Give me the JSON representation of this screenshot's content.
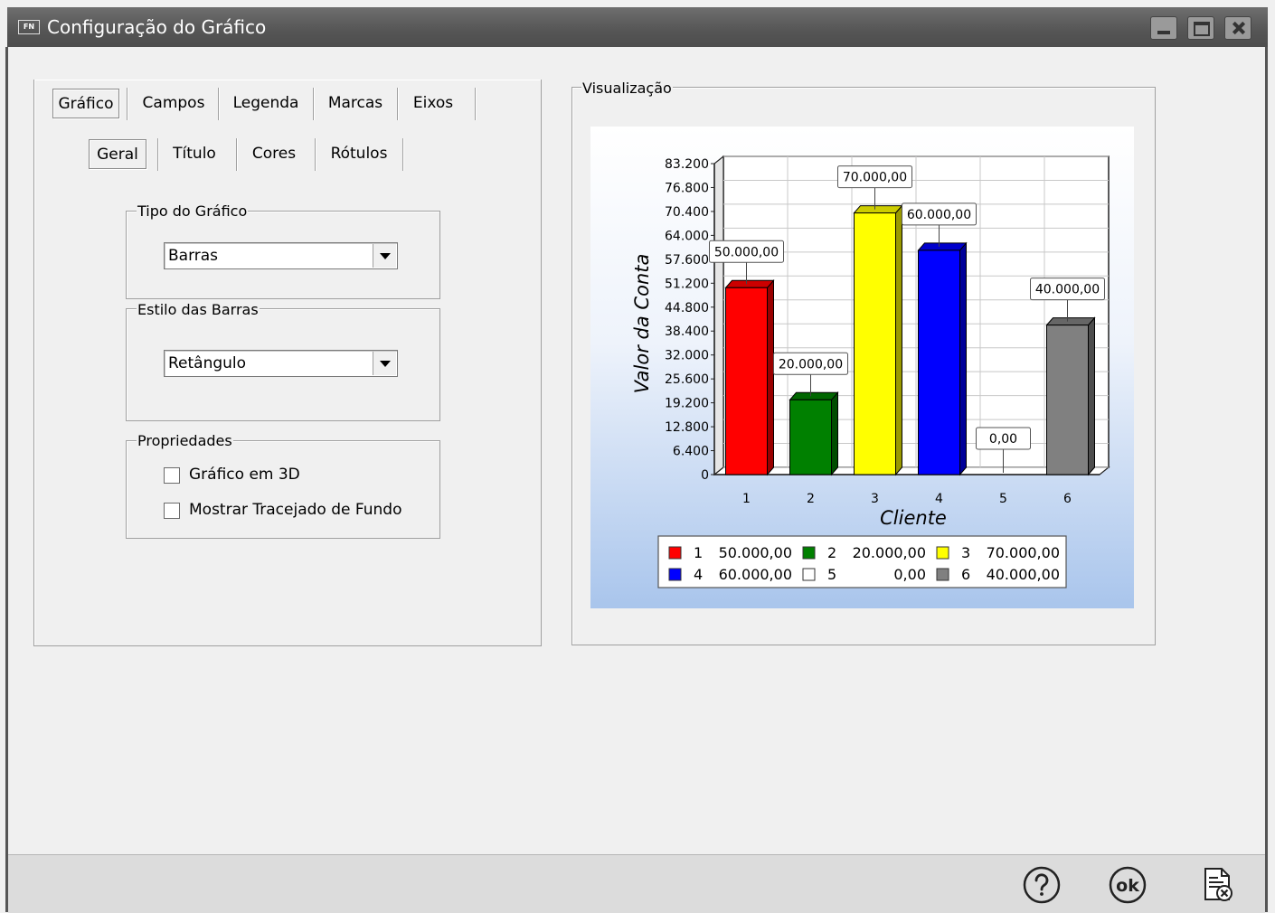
{
  "window": {
    "title": "Configuração do Gráfico",
    "app_icon": "FN"
  },
  "tabs_main": [
    {
      "label": "Gráfico",
      "active": true
    },
    {
      "label": "Campos",
      "active": false
    },
    {
      "label": "Legenda",
      "active": false
    },
    {
      "label": "Marcas",
      "active": false
    },
    {
      "label": "Eixos",
      "active": false
    }
  ],
  "tabs_sub": [
    {
      "label": "Geral",
      "active": true
    },
    {
      "label": "Título",
      "active": false
    },
    {
      "label": "Cores",
      "active": false
    },
    {
      "label": "Rótulos",
      "active": false
    }
  ],
  "tipo_grafico": {
    "legend": "Tipo do Gráfico",
    "value": "Barras"
  },
  "estilo_barras": {
    "legend": "Estilo das Barras",
    "value": "Retângulo"
  },
  "propriedades": {
    "legend": "Propriedades",
    "checkboxes": [
      {
        "label": "Gráfico em 3D",
        "checked": false
      },
      {
        "label": "Mostrar Tracejado de Fundo",
        "checked": false
      }
    ]
  },
  "preview": {
    "legend": "Visualização"
  },
  "chart_data": {
    "type": "bar",
    "categories": [
      "1",
      "2",
      "3",
      "4",
      "5",
      "6"
    ],
    "values": [
      50000,
      20000,
      70000,
      60000,
      0,
      40000
    ],
    "data_labels": [
      "50.000,00",
      "20.000,00",
      "70.000,00",
      "60.000,00",
      "0,00",
      "40.000,00"
    ],
    "colors": [
      "#ff0000",
      "#008000",
      "#ffff00",
      "#0000ff",
      "#ffffff",
      "#808080"
    ],
    "ylabel": "Valor da Conta",
    "xlabel": "Cliente",
    "ylim": [
      0,
      83200
    ],
    "yticks": [
      0,
      6400,
      12800,
      19200,
      25600,
      32000,
      38400,
      44800,
      51200,
      57600,
      64000,
      70400,
      76800,
      83200
    ],
    "ytick_labels": [
      "0",
      "6.400",
      "12.800",
      "19.200",
      "25.600",
      "32.000",
      "38.400",
      "44.800",
      "51.200",
      "57.600",
      "64.000",
      "70.400",
      "76.800",
      "83.200"
    ],
    "grid": true,
    "legend_position": "bottom",
    "legend": [
      {
        "name": "1",
        "value": "50.000,00"
      },
      {
        "name": "2",
        "value": "20.000,00"
      },
      {
        "name": "3",
        "value": "70.000,00"
      },
      {
        "name": "4",
        "value": "60.000,00"
      },
      {
        "name": "5",
        "value": "0,00"
      },
      {
        "name": "6",
        "value": "40.000,00"
      }
    ]
  },
  "footer": {
    "help_icon": "help-icon",
    "ok_icon": "ok-icon",
    "cancel_icon": "cancel-document-icon",
    "ok_label": "ok"
  }
}
